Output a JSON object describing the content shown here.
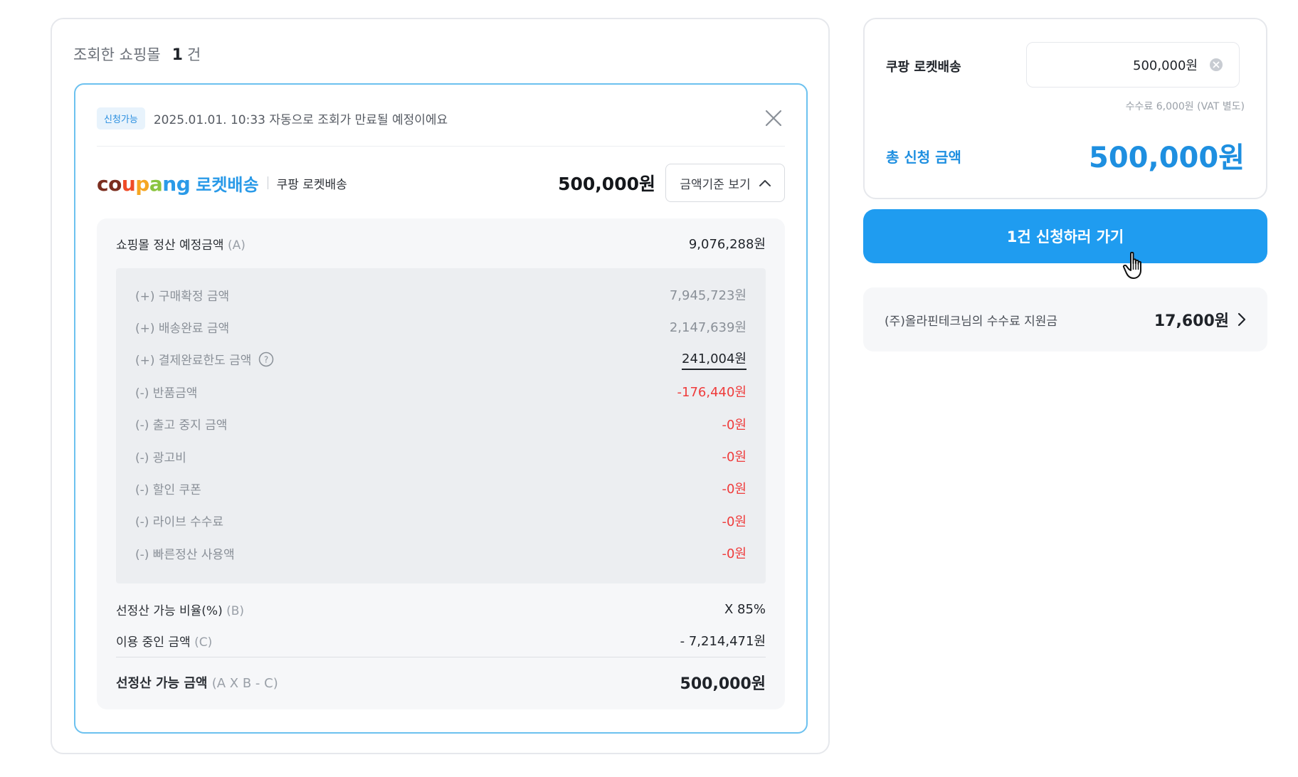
{
  "header": {
    "label": "조회한 쇼핑몰",
    "count": "1",
    "unit": "건"
  },
  "card": {
    "badge": "신청가능",
    "notice": "2025.01.01. 10:33 자동으로 조회가 만료될 예정이에요",
    "logo": {
      "letters": [
        "c",
        "o",
        "u",
        "p",
        "a",
        "n",
        "g"
      ],
      "letter_colors": [
        "#7b2e1f",
        "#7b2e1f",
        "#ef4b27",
        "#f5a623",
        "#8ac43f",
        "#2a9ae8",
        "#2a9ae8"
      ],
      "rocket": "로켓배송"
    },
    "mall_name": "쿠팡 로켓배송",
    "mall_amount": "500,000원",
    "detail_button": "금액기준 보기",
    "settlement": {
      "label": "쇼핑몰 정산 예정금액",
      "sub": "(A)",
      "value": "9,076,288원"
    },
    "items": [
      {
        "label": "(+) 구매확정 금액",
        "value": "7,945,723원",
        "type": "normal"
      },
      {
        "label": "(+) 배송완료 금액",
        "value": "2,147,639원",
        "type": "normal"
      },
      {
        "label": "(+) 결제완료한도 금액",
        "value": "241,004원",
        "type": "link",
        "help": true
      },
      {
        "label": "(-) 반품금액",
        "value": "-176,440원",
        "type": "neg"
      },
      {
        "label": "(-) 출고 중지 금액",
        "value": "-0원",
        "type": "neg"
      },
      {
        "label": "(-) 광고비",
        "value": "-0원",
        "type": "neg"
      },
      {
        "label": "(-) 할인 쿠폰",
        "value": "-0원",
        "type": "neg"
      },
      {
        "label": "(-) 라이브 수수료",
        "value": "-0원",
        "type": "neg"
      },
      {
        "label": "(-) 빠른정산 사용액",
        "value": "-0원",
        "type": "neg"
      }
    ],
    "ratio": {
      "label": "선정산 가능 비율(%)",
      "sub": "(B)",
      "value": "X 85%"
    },
    "in_use": {
      "label": "이용 중인 금액",
      "sub": "(C)",
      "value": "- 7,214,471원"
    },
    "available": {
      "label": "선정산 가능 금액",
      "sub": "(A X B - C)",
      "value": "500,000원"
    }
  },
  "summary": {
    "mall_label": "쿠팡 로켓배송",
    "amount_input": "500,000원",
    "fee_note": "수수료 6,000원 (VAT 별도)",
    "total_label": "총 신청 금액",
    "total_value": "500,000원"
  },
  "apply_button": "1건 신청하러 가기",
  "support": {
    "label": "(주)올라핀테크님의 수수료 지원금",
    "value": "17,600원"
  },
  "colors": {
    "accent": "#1f9cf0",
    "negative": "#ef3b3b",
    "card_border": "#6cc1ef"
  }
}
